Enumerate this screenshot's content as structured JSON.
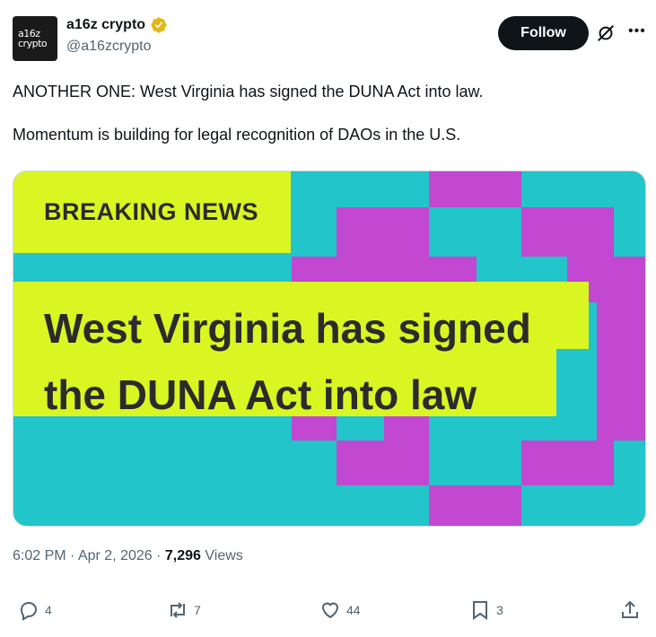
{
  "author": {
    "display_name": "a16z crypto",
    "handle": "@a16zcrypto",
    "avatar_text_line1": "a16z",
    "avatar_text_line2": "crypto",
    "verified_badge": "gold-verified-badge-icon"
  },
  "header": {
    "follow_label": "Follow",
    "grok_icon": "grok-icon",
    "more_icon": "more-icon"
  },
  "tweet": {
    "line1": "ANOTHER ONE: West Virginia has signed the DUNA Act into law.",
    "line2": "Momentum is building for legal recognition of DAOs in the U.S."
  },
  "media": {
    "kicker": "BREAKING NEWS",
    "headline_line1": "West Virginia has signed",
    "headline_line2": "the DUNA Act into law",
    "colors": {
      "teal": "#22c5c9",
      "magenta": "#c247d1",
      "lime": "#d9f623"
    }
  },
  "meta": {
    "time": "6:02 PM",
    "date": "Apr 2, 2026",
    "views_count": "7,296",
    "views_label": "Views"
  },
  "actions": {
    "replies": "4",
    "reposts": "7",
    "likes": "44",
    "bookmarks": "3"
  }
}
